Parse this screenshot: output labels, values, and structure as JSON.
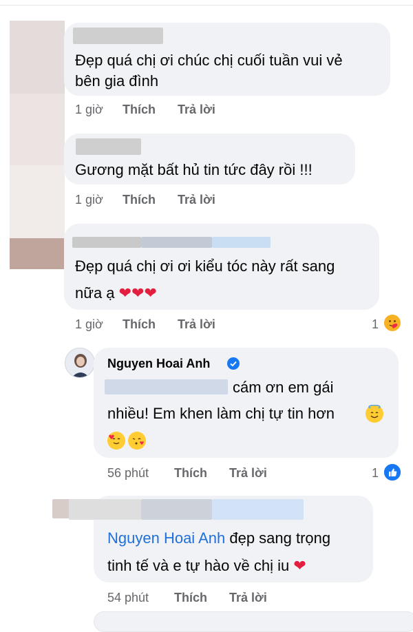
{
  "comments": [
    {
      "text_lines": [
        "Đẹp quá chị ơi chúc chị cuối tuần vui vẻ",
        "bên gia đình"
      ],
      "time": "1 giờ",
      "like_label": "Thích",
      "reply_label": "Trả lời"
    },
    {
      "text_lines": [
        "Gương mặt bất hủ tin tức đây rồi !!!"
      ],
      "time": "1 giờ",
      "like_label": "Thích",
      "reply_label": "Trả lời"
    },
    {
      "text_lines": [
        "Đẹp quá chị ơi ơi kiểu tóc này rất sang",
        "nữa ạ"
      ],
      "hearts": "❤❤❤",
      "time": "1 giờ",
      "like_label": "Thích",
      "reply_label": "Trả lời",
      "reaction_count": "1",
      "reaction": "care-emoji"
    },
    {
      "author": "Nguyen Hoai Anh",
      "verified": true,
      "text_lines": [
        "cám ơn em gái",
        "nhiều! Em khen làm chị tự tin hơn"
      ],
      "time": "56 phút",
      "like_label": "Thích",
      "reply_label": "Trả lời",
      "reaction_count": "1",
      "reaction": "like"
    },
    {
      "mention": "Nguyen Hoai Anh",
      "text_lines": [
        "đẹp sang trọng",
        "tinh tế và e tự hào về chị iu"
      ],
      "heart": "❤",
      "time": "54 phút",
      "like_label": "Thích",
      "reply_label": "Trả lời"
    }
  ],
  "colors": {
    "bubble": "#f0f2f5",
    "meta": "#65676b",
    "mention": "#216fdb",
    "like_blue": "#1877f2",
    "heart": "#e41e3f"
  }
}
